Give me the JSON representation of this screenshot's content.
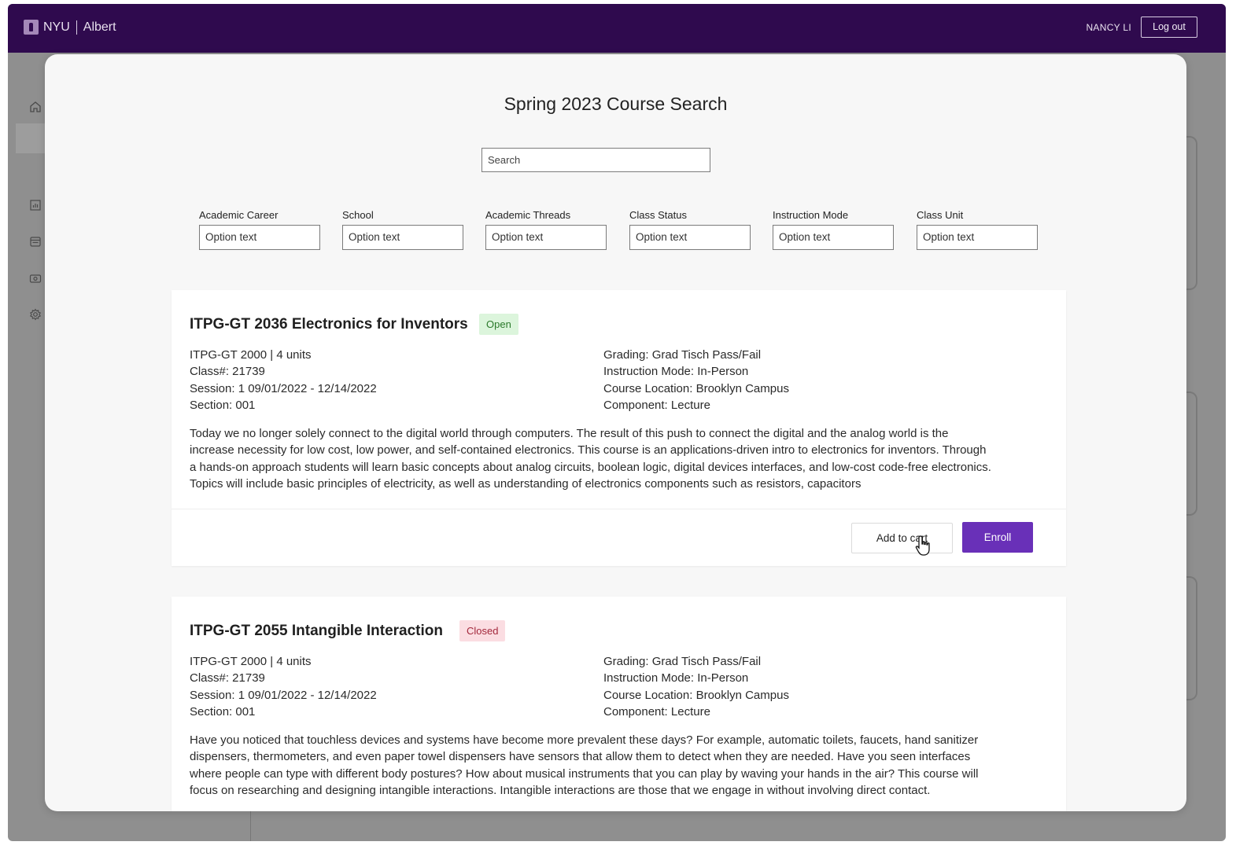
{
  "header": {
    "brand_left": "NYU",
    "brand_right": "Albert",
    "user_name": "NANCY LI",
    "logout_label": "Log out"
  },
  "sidebar": {
    "icons": [
      "home-icon",
      "chart-icon",
      "calendar-icon",
      "money-icon",
      "gear-icon"
    ]
  },
  "search_page": {
    "title": "Spring 2023 Course Search",
    "search_placeholder": "Search",
    "filters": [
      {
        "label": "Academic Career",
        "value": "Option text"
      },
      {
        "label": "School",
        "value": "Option text"
      },
      {
        "label": "Academic Threads",
        "value": "Option text"
      },
      {
        "label": "Class Status",
        "value": "Option text"
      },
      {
        "label": "Instruction Mode",
        "value": "Option text"
      },
      {
        "label": "Class Unit",
        "value": "Option text"
      }
    ]
  },
  "courses": [
    {
      "title": "ITPG-GT 2036 Electronics for Inventors",
      "status": "Open",
      "left_details": [
        "ITPG-GT 2000 | 4 units",
        "Class#: 21739",
        "Session: 1 09/01/2022 - 12/14/2022",
        "Section: 001"
      ],
      "right_details": [
        "Grading: Grad Tisch Pass/Fail",
        "Instruction Mode: In-Person",
        "Course Location: Brooklyn Campus",
        "Component: Lecture"
      ],
      "description": "Today we no longer solely connect to the digital world through computers. The result of this push to connect the digital and the analog world is the increase necessity for low cost, low power, and self-contained electronics. This course is an applications-driven intro to electronics for inventors. Through a hands-on approach students will learn basic concepts about analog circuits, boolean logic, digital devices interfaces, and low-cost code-free electronics. Topics will include basic principles of electricity, as well as understanding of electronics components such as resistors, capacitors",
      "add_to_cart_label": "Add to cart",
      "enroll_label": "Enroll"
    },
    {
      "title": "ITPG-GT 2055 Intangible Interaction",
      "status": "Closed",
      "left_details": [
        "ITPG-GT 2000 | 4 units",
        "Class#: 21739",
        "Session: 1 09/01/2022 - 12/14/2022",
        "Section: 001"
      ],
      "right_details": [
        "Grading: Grad Tisch Pass/Fail",
        "Instruction Mode: In-Person",
        "Course Location: Brooklyn Campus",
        "Component: Lecture"
      ],
      "description": "Have you noticed that touchless devices and systems have become more prevalent these days? For example, automatic toilets, faucets, hand sanitizer dispensers, thermometers, and even paper towel dispensers have sensors that allow them to detect when they are needed. Have you seen interfaces where people can type with different body postures? How about musical instruments that you can play by waving your hands in the air? This course will focus on researching and designing intangible interactions. Intangible interactions are those that we engage in without involving direct contact."
    }
  ],
  "colors": {
    "header_bg": "#2f0a4e",
    "enroll_bg": "#6930b8",
    "open_badge_bg": "#dcf5dc",
    "closed_badge_bg": "#fbdde2"
  }
}
